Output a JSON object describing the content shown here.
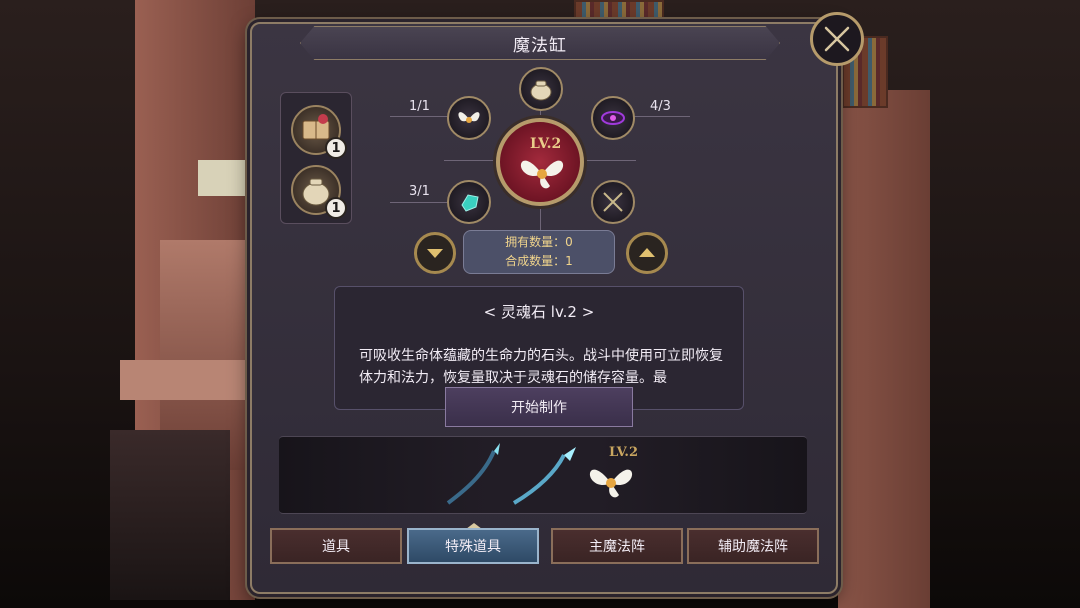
{
  "window": {
    "title": "魔法缸"
  },
  "materials": [
    {
      "icon": "spellbook-icon",
      "count": "1"
    },
    {
      "icon": "pouch-icon",
      "count": "1"
    }
  ],
  "recipe": {
    "top": {
      "icon": "pouch-icon"
    },
    "top_left": {
      "icon": "fairy-wing-icon",
      "ratio": "1/1"
    },
    "top_right": {
      "icon": "dark-orb-icon",
      "ratio": "4/3"
    },
    "bottom_left": {
      "icon": "crystal-icon",
      "ratio": "3/1"
    },
    "bottom_right": {
      "icon": "empty-slot-icon"
    },
    "center": {
      "icon": "soul-stone-icon",
      "level": "LV.2"
    },
    "owned_label": "拥有数量：0",
    "craft_label": "合成数量：1"
  },
  "description": {
    "title": "< 灵魂石 lv.2 >",
    "text": "可吸收生命体蕴藏的生命力的石头。战斗中使用可立即恢复体力和法力，恢复量取决于灵魂石的储存容量。最"
  },
  "craft_button": "开始制作",
  "preview": {
    "level": "LV.2"
  },
  "tabs": [
    {
      "label": "道具",
      "active": false
    },
    {
      "label": "特殊道具",
      "active": true
    },
    {
      "label": "主魔法阵",
      "active": false
    },
    {
      "label": "辅助魔法阵",
      "active": false
    }
  ],
  "colors": {
    "accent_gold": "#b69b6b",
    "center_red": "#a32a3c",
    "active_tab": "#2e4a66"
  }
}
